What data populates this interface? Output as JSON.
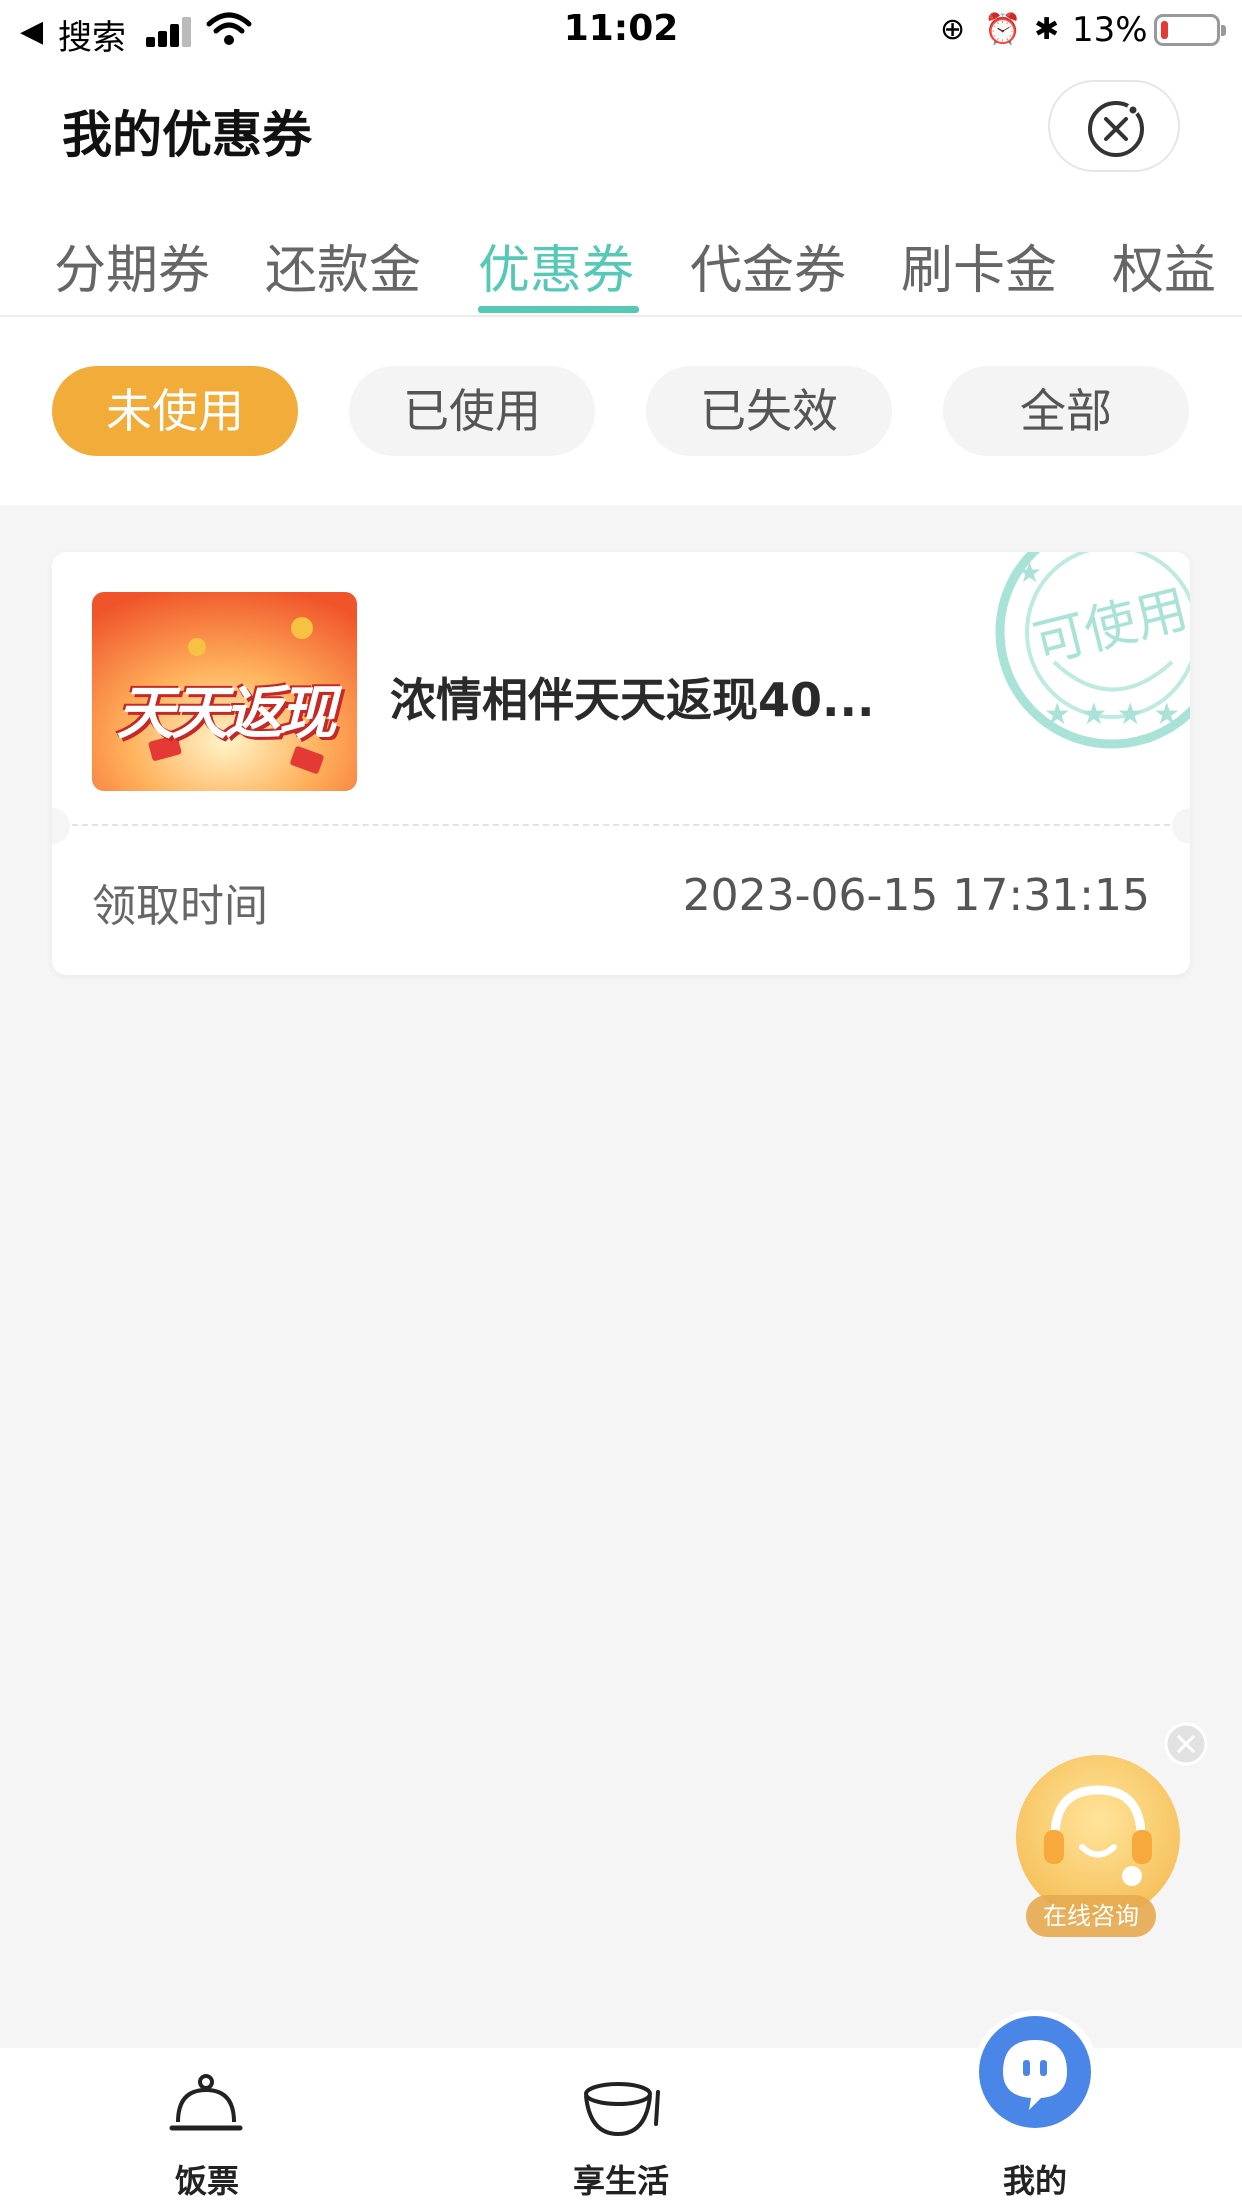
{
  "status_bar": {
    "back_app": "搜索",
    "time": "11:02",
    "battery_percent": "13%",
    "battery_level": 0.13
  },
  "header": {
    "title": "我的优惠券",
    "close_icon": "close-circle-icon"
  },
  "category_tabs": [
    {
      "label": "分期券",
      "active": false
    },
    {
      "label": "还款金",
      "active": false
    },
    {
      "label": "优惠券",
      "active": true
    },
    {
      "label": "代金券",
      "active": false
    },
    {
      "label": "刷卡金",
      "active": false
    },
    {
      "label": "权益",
      "active": false
    }
  ],
  "status_filters": [
    {
      "label": "未使用",
      "active": true
    },
    {
      "label": "已使用",
      "active": false
    },
    {
      "label": "已失效",
      "active": false
    },
    {
      "label": "全部",
      "active": false
    }
  ],
  "coupon": {
    "image_text": "天天返现",
    "name": "浓情相伴天天返现40...",
    "stamp": "可使用",
    "receive_label": "领取时间",
    "receive_time": "2023-06-15 17:31:15"
  },
  "consult": {
    "label": "在线咨询"
  },
  "bottom_nav": [
    {
      "label": "饭票",
      "icon": "cloche-icon"
    },
    {
      "label": "享生活",
      "icon": "bowl-icon"
    },
    {
      "label": "我的",
      "icon": "mascot-icon"
    }
  ],
  "colors": {
    "accent_teal": "#55c8b6",
    "pill_orange": "#f2ac3a",
    "nav_blue": "#4a86e8"
  }
}
